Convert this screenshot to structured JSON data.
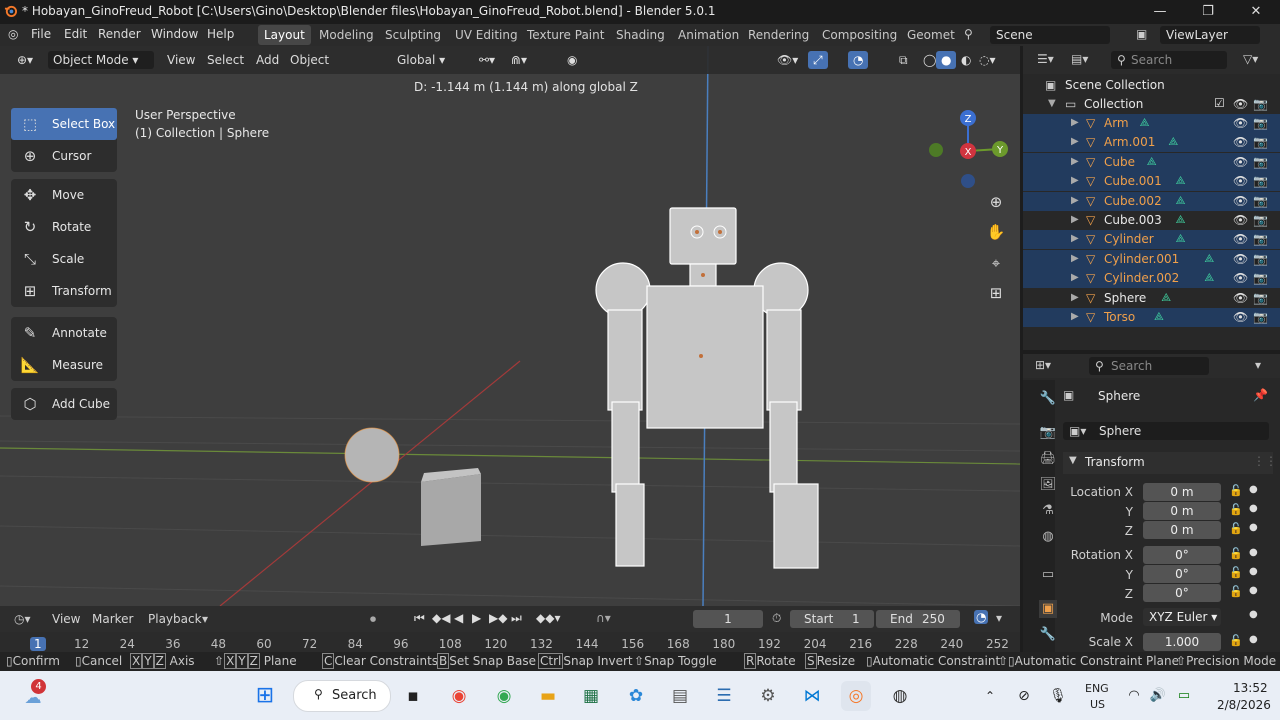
{
  "window": {
    "title": "* Hobayan_GinoFreud_Robot [C:\\Users\\Gino\\Desktop\\Blender files\\Hobayan_GinoFreud_Robot.blend] - Blender 5.0.1"
  },
  "menu": [
    "File",
    "Edit",
    "Render",
    "Window",
    "Help"
  ],
  "workspaces": [
    "Layout",
    "Modeling",
    "Sculpting",
    "UV Editing",
    "Texture Paint",
    "Shading",
    "Animation",
    "Rendering",
    "Compositing",
    "Geomet"
  ],
  "scene": {
    "name": "Scene",
    "viewlayer": "ViewLayer"
  },
  "viewport": {
    "mode": "Object Mode",
    "menus": [
      "View",
      "Select",
      "Add",
      "Object"
    ],
    "orientation": "Global",
    "status_text": "D: -1.144 m (1.144 m) along global Z",
    "perspective": "User Perspective",
    "collection_info": "(1) Collection | Sphere",
    "gizmo": {
      "z": "Z",
      "x": "X",
      "y": "Y"
    },
    "tools": [
      "Select Box",
      "Cursor",
      "Move",
      "Rotate",
      "Scale",
      "Transform",
      "Annotate",
      "Measure",
      "Add Cube"
    ]
  },
  "outliner": {
    "search_placeholder": "Search",
    "scene_collection": "Scene Collection",
    "collection": "Collection",
    "objects": [
      "Arm",
      "Arm.001",
      "Cube",
      "Cube.001",
      "Cube.002",
      "Cube.003",
      "Cylinder",
      "Cylinder.001",
      "Cylinder.002",
      "Sphere",
      "Torso"
    ],
    "selected": [
      true,
      true,
      true,
      true,
      true,
      false,
      true,
      true,
      true,
      false,
      true
    ]
  },
  "properties": {
    "search_placeholder": "Search",
    "object_name": "Sphere",
    "datablock": "Sphere",
    "panel": "Transform",
    "location_label": "Location X",
    "location": [
      "0 m",
      "0 m",
      "0 m"
    ],
    "rotation_label": "Rotation X",
    "rotation": [
      "0°",
      "0°",
      "0°"
    ],
    "axis_y": "Y",
    "axis_z": "Z",
    "mode_label": "Mode",
    "mode_value": "XYZ Euler",
    "scale_label": "Scale X",
    "scale_x": "1.000"
  },
  "timeline": {
    "menus": [
      "View",
      "Marker",
      "Playback"
    ],
    "current_frame": "1",
    "start_label": "Start",
    "start": "1",
    "end_label": "End",
    "end": "250",
    "ticks": [
      "1",
      "12",
      "24",
      "36",
      "48",
      "60",
      "72",
      "84",
      "96",
      "108",
      "120",
      "132",
      "144",
      "156",
      "168",
      "180",
      "192",
      "204",
      "216",
      "228",
      "240",
      "252"
    ]
  },
  "statusbar": [
    "Confirm",
    "Cancel",
    "Axis",
    "Plane",
    "Clear Constraints",
    "Set Snap Base",
    "Snap Invert",
    "Snap Toggle",
    "Rotate",
    "Resize",
    "Automatic Constraint",
    "Automatic Constraint Plane",
    "Precision Mode"
  ],
  "statusbar_keys": {
    "x": "X",
    "y": "Y",
    "z": "Z",
    "c": "C",
    "b": "B",
    "ctrl": "Ctrl",
    "r": "R",
    "s": "S"
  },
  "taskbar": {
    "search": "Search",
    "weather_badge": "4",
    "lang": "ENG",
    "region": "US",
    "time": "13:52",
    "date": "2/8/2026"
  },
  "colors": {
    "accent": "#4772b3",
    "object_orange": "#f0a04b",
    "selected_row": "#223b5e"
  }
}
